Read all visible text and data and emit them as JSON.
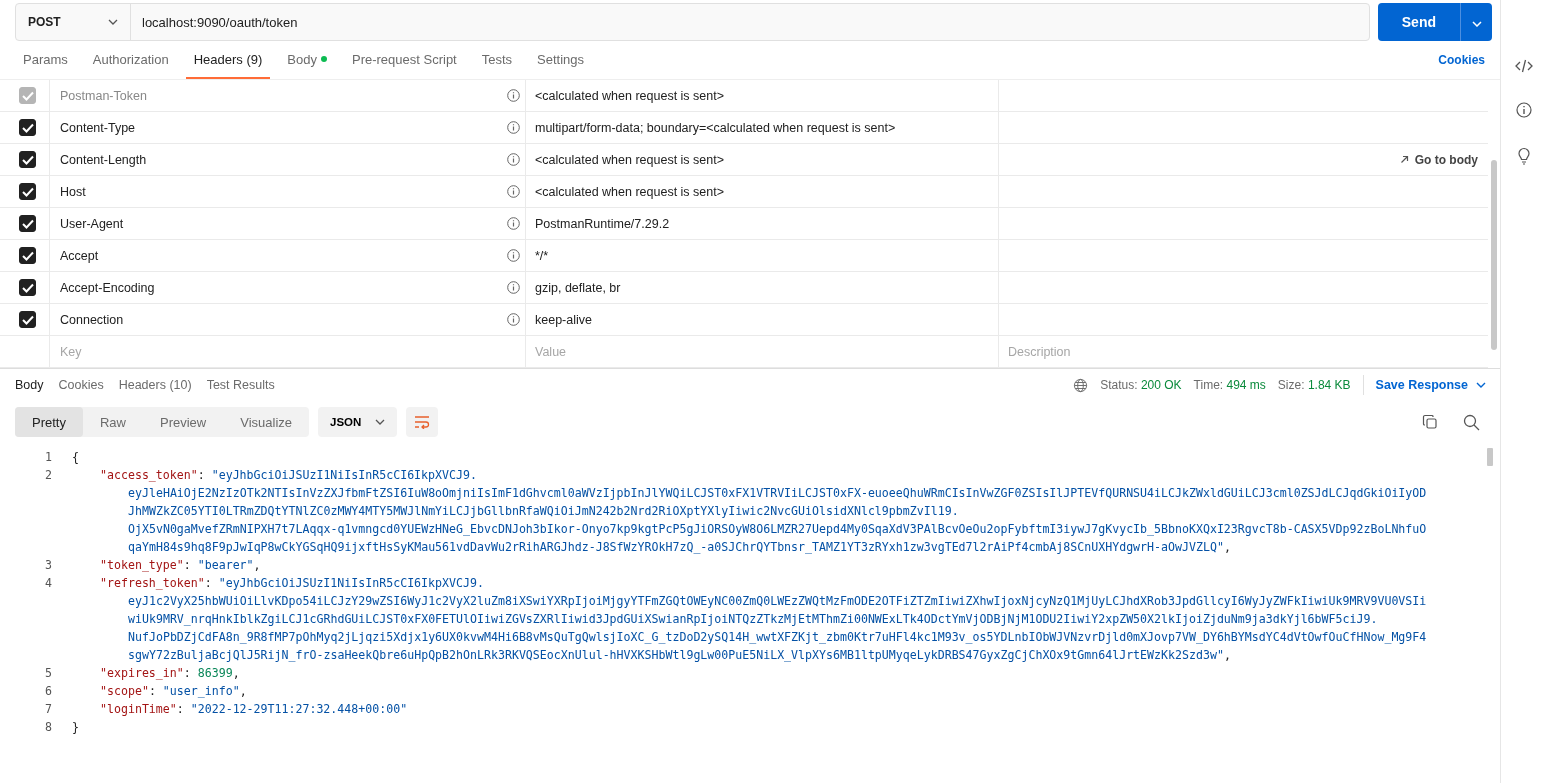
{
  "request": {
    "method": "POST",
    "url": "localhost:9090/oauth/token",
    "send_label": "Send"
  },
  "request_tabs": [
    {
      "label": "Params",
      "selected": false,
      "modified": false
    },
    {
      "label": "Authorization",
      "selected": false,
      "modified": false
    },
    {
      "label": "Headers (9)",
      "selected": true,
      "modified": false
    },
    {
      "label": "Body",
      "selected": false,
      "modified": true
    },
    {
      "label": "Pre-request Script",
      "selected": false,
      "modified": false
    },
    {
      "label": "Tests",
      "selected": false,
      "modified": false
    },
    {
      "label": "Settings",
      "selected": false,
      "modified": false
    }
  ],
  "cookies_link": "Cookies",
  "headers": {
    "rows": [
      {
        "checked": true,
        "disabled": true,
        "key": "Postman-Token",
        "value": "<calculated when request is sent>"
      },
      {
        "checked": true,
        "disabled": false,
        "key": "Content-Type",
        "value": "multipart/form-data; boundary=<calculated when request is sent>"
      },
      {
        "checked": true,
        "disabled": false,
        "key": "Content-Length",
        "value": "<calculated when request is sent>",
        "action": "Go to body"
      },
      {
        "checked": true,
        "disabled": false,
        "key": "Host",
        "value": "<calculated when request is sent>"
      },
      {
        "checked": true,
        "disabled": false,
        "key": "User-Agent",
        "value": "PostmanRuntime/7.29.2"
      },
      {
        "checked": true,
        "disabled": false,
        "key": "Accept",
        "value": "*/*"
      },
      {
        "checked": true,
        "disabled": false,
        "key": "Accept-Encoding",
        "value": "gzip, deflate, br"
      },
      {
        "checked": true,
        "disabled": false,
        "key": "Connection",
        "value": "keep-alive"
      }
    ],
    "new_row": {
      "key": {
        "placeholder": "Key"
      },
      "value": {
        "placeholder": "Value"
      },
      "description": {
        "placeholder": "Description"
      }
    }
  },
  "response": {
    "tabs": [
      {
        "label": "Body",
        "selected": true
      },
      {
        "label": "Cookies",
        "selected": false
      },
      {
        "label": "Headers (10)",
        "selected": false
      },
      {
        "label": "Test Results",
        "selected": false
      }
    ],
    "status": {
      "label": "Status:",
      "value": "200 OK"
    },
    "time": {
      "label": "Time:",
      "value": "494 ms"
    },
    "size": {
      "label": "Size:",
      "value": "1.84 KB"
    },
    "save_label": "Save Response",
    "view_modes": [
      {
        "label": "Pretty",
        "selected": true
      },
      {
        "label": "Raw",
        "selected": false
      },
      {
        "label": "Preview",
        "selected": false
      },
      {
        "label": "Visualize",
        "selected": false
      }
    ],
    "format": "JSON",
    "lines": [
      {
        "num": "1",
        "indented": false,
        "segments": [
          {
            "kind": "punct",
            "text": "{"
          }
        ]
      },
      {
        "num": "2",
        "indented": true,
        "segments": [
          {
            "kind": "key",
            "text": "\"access_token\""
          },
          {
            "kind": "punct",
            "text": ": "
          },
          {
            "kind": "string",
            "text": "\"eyJhbGciOiJSUzI1NiIsInR5cCI6IkpXVCJ9."
          }
        ],
        "cont": [
          "eyJleHAiOjE2NzIzOTk2NTIsInVzZXJfbmFtZSI6IuW8oOmjniIsImF1dGhvcml0aWVzIjpbInJlYWQiLCJST0xFX1VTRVIiLCJST0xFX-euoeeQhuWRmCIsInVwZGF0ZSIsIlJPTEVfQURNSU4iLCJkZWxldGUiLCJ3cml0ZSJdLCJqdGkiOiIyOD",
          "JhMWZkZC05YTI0LTRmZDQtYTNlZC0zMWY4MTY5MWJlNmYiLCJjbGllbnRfaWQiOiJmN242b2Nrd2RiOXptYXlyIiwic2NvcGUiOlsidXNlcl9pbmZvIl19.",
          "OjX5vN0gaMvefZRmNIPXH7t7LAqqx-q1vmngcd0YUEWzHNeG_EbvcDNJoh3bIkor-Onyo7kp9kgtPcP5gJiORSOyW8O6LMZR27Uepd4My0SqaXdV3PAlBcvOeOu2opFybftmI3iywJ7gKvycIb_5BbnoKXQxI23RgvcT8b-CASX5VDp92zBoLNhfuO",
          "qaYmH84s9hq8F9pJwIqP8wCkYGSqHQ9ijxftHsSyKMau561vdDavWu2rRihARGJhdz-J8SfWzYROkH7zQ_-a0SJChrQYTbnsr_TAMZ1YT3zRYxh1zw3vgTEd7l2rAiPf4cmbAj8SCnUXHYdgwrH-aOwJVZLQ\""
        ],
        "end": ","
      },
      {
        "num": "3",
        "indented": true,
        "segments": [
          {
            "kind": "key",
            "text": "\"token_type\""
          },
          {
            "kind": "punct",
            "text": ": "
          },
          {
            "kind": "string",
            "text": "\"bearer\""
          },
          {
            "kind": "punct",
            "text": ","
          }
        ]
      },
      {
        "num": "4",
        "indented": true,
        "segments": [
          {
            "kind": "key",
            "text": "\"refresh_token\""
          },
          {
            "kind": "punct",
            "text": ": "
          },
          {
            "kind": "string",
            "text": "\"eyJhbGciOiJSUzI1NiIsInR5cCI6IkpXVCJ9."
          }
        ],
        "cont": [
          "eyJ1c2VyX25hbWUiOiLlvKDpo54iLCJzY29wZSI6WyJ1c2VyX2luZm8iXSwiYXRpIjoiMjgyYTFmZGQtOWEyNC00ZmQ0LWEzZWQtMzFmODE2OTFiZTZmIiwiZXhwIjoxNjcyNzQ1MjUyLCJhdXRob3JpdGllcyI6WyJyZWFkIiwiUk9MRV9VU0VSIi",
          "wiUk9MRV_nrqHnkIblkZgiLCJ1cGRhdGUiLCJST0xFX0FETUlOIiwiZGVsZXRlIiwid3JpdGUiXSwianRpIjoiNTQzZTkzMjEtMThmZi00NWExLTk4ODctYmVjODBjNjM1ODU2IiwiY2xpZW50X2lkIjoiZjduNm9ja3dkYjl6bWF5ciJ9.",
          "NufJoPbDZjCdFA8n_9R8fMP7pOhMyq2jLjqzi5Xdjx1y6UX0kvwM4Hi6B8vMsQuTgQwlsjIoXC_G_tzDoD2ySQ14H_wwtXFZKjt_zbm0Ktr7uHFl4kc1M93v_os5YDLnbIObWJVNzvrDjld0mXJovp7VW_DY6hBYMsdYC4dVtOwfOuCfHNow_Mg9F4",
          "sgwY72zBuljaBcjQlJ5RijN_frO-zsaHeekQbre6uHpQpB2hOnLRk3RKVQSEocXnUlul-hHVXKSHbWtl9gLw00PuE5NiLX_VlpXYs6MB1ltpUMyqeLykDRBS47GyxZgCjChXOx9tGmn64lJrtEWzKk2Szd3w\""
        ],
        "end": ","
      },
      {
        "num": "5",
        "indented": true,
        "segments": [
          {
            "kind": "key",
            "text": "\"expires_in\""
          },
          {
            "kind": "punct",
            "text": ": "
          },
          {
            "kind": "number",
            "text": "86399"
          },
          {
            "kind": "punct",
            "text": ","
          }
        ]
      },
      {
        "num": "6",
        "indented": true,
        "segments": [
          {
            "kind": "key",
            "text": "\"scope\""
          },
          {
            "kind": "punct",
            "text": ": "
          },
          {
            "kind": "string",
            "text": "\"user_info\""
          },
          {
            "kind": "punct",
            "text": ","
          }
        ]
      },
      {
        "num": "7",
        "indented": true,
        "segments": [
          {
            "kind": "key",
            "text": "\"loginTime\""
          },
          {
            "kind": "punct",
            "text": ": "
          },
          {
            "kind": "string",
            "text": "\"2022-12-29T11:27:32.448+00:00\""
          }
        ]
      },
      {
        "num": "8",
        "indented": false,
        "segments": [
          {
            "kind": "punct",
            "text": "}"
          }
        ]
      }
    ]
  }
}
